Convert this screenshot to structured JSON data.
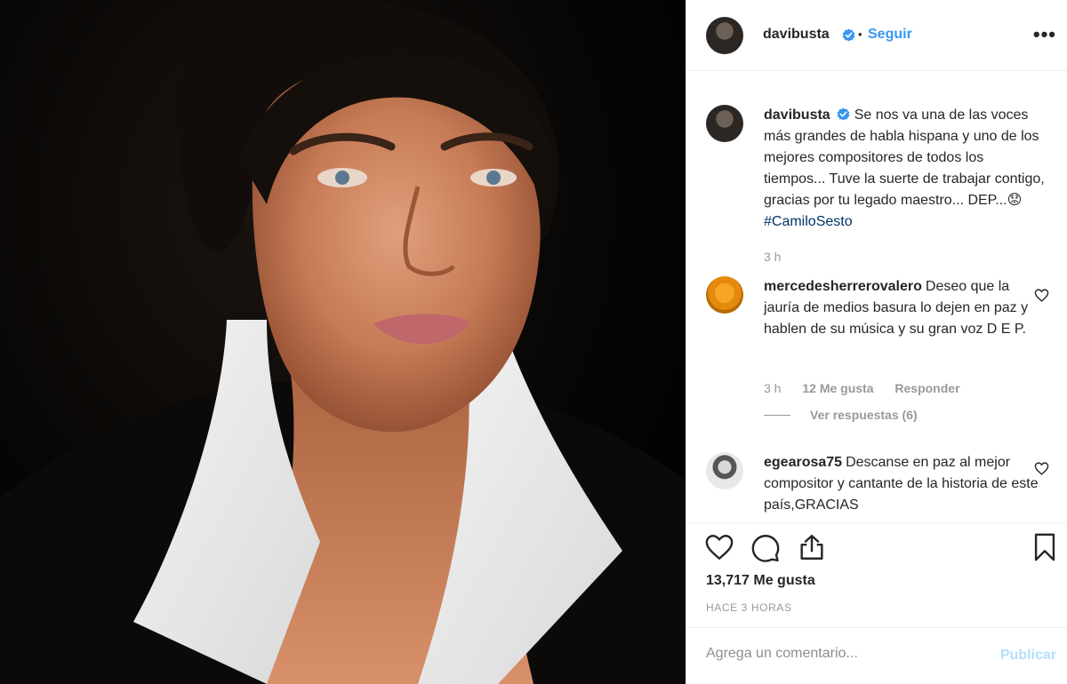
{
  "post": {
    "author": "davibusta",
    "follow_label": "Seguir",
    "separator": "•",
    "more_label": "•••"
  },
  "caption": {
    "username": "davibusta",
    "text": "Se nos va una de las voces más grandes de habla hispana y uno de los mejores compositores de todos los tiempos... Tuve la suerte de trabajar contigo, gracias por tu legado maestro... DEP...",
    "emoji": "😟",
    "hashtag": "#CamiloSesto",
    "time": "3 h"
  },
  "comments": [
    {
      "username": "mercedesherrerovalero",
      "text": "Deseo que la jauría de medios basura lo dejen en paz y hablen de su música y su gran voz D E P.",
      "time": "3 h",
      "likes": "12 Me gusta",
      "reply": "Responder",
      "view_replies": "Ver respuestas (6)"
    },
    {
      "username": "egearosa75",
      "text": "Descanse en paz al mejor compositor y cantante de la historia de este país,GRACIAS"
    }
  ],
  "footer": {
    "likes": "13,717 Me gusta",
    "timestamp": "HACE 3 HORAS",
    "comment_placeholder": "Agrega un comentario...",
    "publish_label": "Publicar"
  },
  "colors": {
    "link": "#3897f0",
    "hashtag": "#003569",
    "muted": "#999999",
    "publish_disabled": "#b2dffc",
    "border": "#efefef"
  },
  "icons": [
    "verified-badge-icon",
    "more-options-icon",
    "heart-icon",
    "comment-icon",
    "share-icon",
    "bookmark-icon"
  ]
}
